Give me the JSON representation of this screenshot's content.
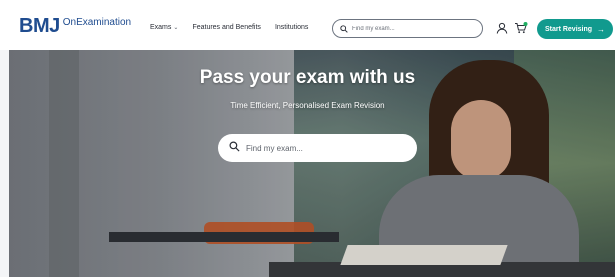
{
  "header": {
    "logo_mark": "BMJ",
    "logo_text": "OnExamination",
    "nav": [
      {
        "label": "Exams",
        "has_dropdown": true
      },
      {
        "label": "Features and Benefits",
        "has_dropdown": false
      },
      {
        "label": "Institutions",
        "has_dropdown": false
      }
    ],
    "search_placeholder": "Find my exam...",
    "cta_label": "Start Revising",
    "icons": [
      "search-icon",
      "user-icon",
      "cart-icon",
      "arrow-right-icon"
    ],
    "colors": {
      "brand": "#1f4c8f",
      "accent": "#119a8e"
    }
  },
  "hero": {
    "title": "Pass your exam with us",
    "subtitle": "Time Efficient, Personalised Exam Revision",
    "search_placeholder": "Find my exam..."
  }
}
